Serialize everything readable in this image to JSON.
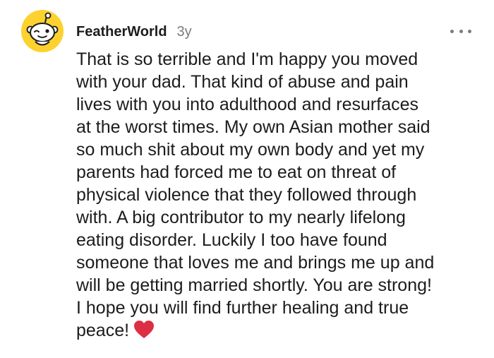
{
  "comment": {
    "username": "FeatherWorld",
    "age": "3y",
    "more_icon": "more-horizontal-icon",
    "body_lines": [
      "That is so terrible and I'm happy you moved",
      "with your dad. That kind of abuse and pain",
      "lives with you into adulthood and resurfaces",
      "at the worst times. My own Asian mother said",
      "so much shit about my own body and yet my",
      "parents had forced me to eat on threat of",
      "physical violence that they followed through",
      "with. A big contributor to my nearly lifelong",
      "eating disorder. Luckily I too have found",
      "someone that loves me and brings me up and",
      "will be getting married shortly. You are strong!",
      "I hope you will find further healing and true",
      "peace!"
    ],
    "emoji": "heart-emoji",
    "colors": {
      "avatar_yellow": "#fdd22f",
      "heart_red": "#dd2e44",
      "meta_gray": "#7c7c7c"
    }
  }
}
